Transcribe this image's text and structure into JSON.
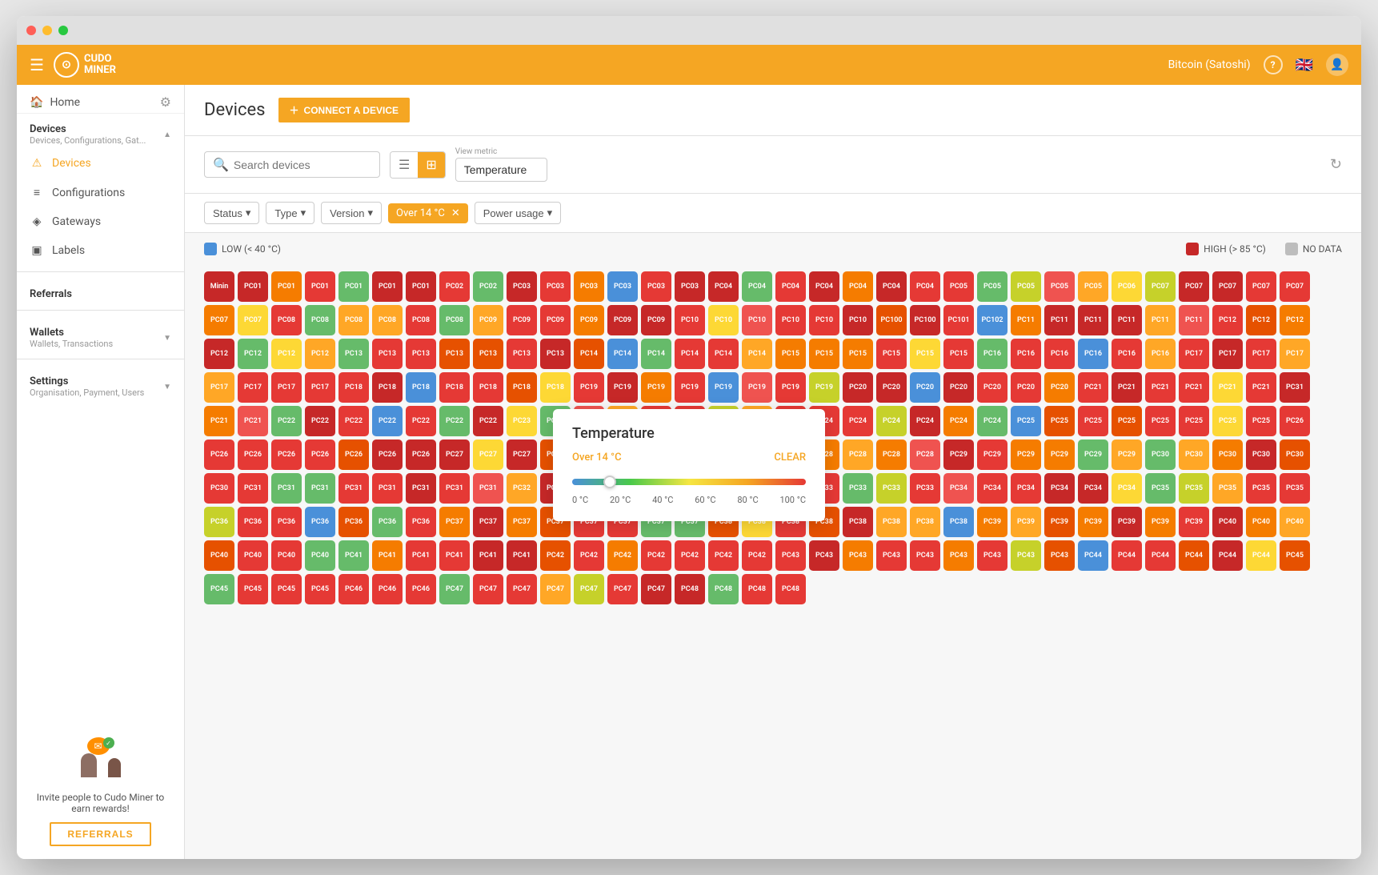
{
  "window": {
    "titlebar": {
      "dots": [
        "red",
        "yellow",
        "green"
      ]
    }
  },
  "topnav": {
    "logo_text": "CUDO\nMINER",
    "currency": "Bitcoin (Satoshi)",
    "help_icon": "?",
    "flag_icon": "🇬🇧"
  },
  "sidebar": {
    "home_label": "Home",
    "sections": [
      {
        "title": "Devices",
        "subtitle": "Devices, Configurations, Gat...",
        "items": [
          {
            "label": "Devices",
            "icon": "⚠",
            "active": true
          },
          {
            "label": "Configurations",
            "icon": "≡"
          },
          {
            "label": "Gateways",
            "icon": "◈"
          },
          {
            "label": "Labels",
            "icon": "▣"
          }
        ]
      },
      {
        "title": "Referrals",
        "subtitle": "",
        "items": []
      },
      {
        "title": "Wallets",
        "subtitle": "Wallets, Transactions",
        "items": []
      },
      {
        "title": "Settings",
        "subtitle": "Organisation, Payment, Users",
        "items": []
      }
    ],
    "promo": {
      "text": "Invite people to Cudo Miner to earn rewards!",
      "button_label": "REFERRALS"
    }
  },
  "content": {
    "title": "Devices",
    "connect_button": "CONNECT A DEVICE",
    "search_placeholder": "Search devices",
    "view_metric_label": "View metric",
    "view_metric_value": "Temperature",
    "filters": {
      "status_label": "Status",
      "type_label": "Type",
      "version_label": "Version",
      "active_filter": "Over 14 °C",
      "power_usage_label": "Power usage"
    },
    "legend": {
      "low_label": "LOW (< 40 °C)",
      "low_color": "#4a90d9",
      "high_label": "HIGH (> 85 °C)",
      "high_color": "#c62828",
      "no_data_label": "NO DATA",
      "no_data_color": "#bdbdbd"
    },
    "popup": {
      "title": "Temperature",
      "filter_active": "Over 14 °C",
      "clear_label": "CLEAR",
      "slider_value": 14,
      "labels": [
        "0 °C",
        "20 °C",
        "40 °C",
        "60 °C",
        "80 °C",
        "100 °C"
      ]
    }
  },
  "devices": {
    "colors": {
      "red_dark": "#c62828",
      "red": "#e53935",
      "orange_dark": "#e65100",
      "orange": "#f57c00",
      "orange_light": "#ffa726",
      "yellow": "#fdd835",
      "yellow_green": "#c6d12a",
      "green": "#66bb6a",
      "blue": "#4a90d9",
      "gray": "#bdbdbd"
    },
    "rows": [
      [
        "Minin",
        "PC01",
        "PC01",
        "PC01",
        "PC01",
        "PC01",
        "PC01",
        "PC02",
        "PC02",
        "PC03",
        "PC03",
        "PC03",
        "PC03",
        "PC03",
        "PC03",
        "PC04",
        "PC04",
        "PC04",
        "PC04",
        "PC04"
      ],
      [
        "PC04",
        "PC04",
        "PC05",
        "PC05",
        "PC05",
        "PC05",
        "PC05",
        "PC06",
        "PC07",
        "PC07",
        "PC07",
        "PC07",
        "PC07",
        "PC07",
        "PC07",
        "PC08",
        "PC08",
        "PC08",
        "PC08",
        "PC08"
      ],
      [
        "PC08",
        "PC09",
        "PC09",
        "PC09",
        "PC09",
        "PC09",
        "PC09",
        "PC10",
        "PC10",
        "PC10",
        "PC10",
        "PC10",
        "PC10",
        "PC100",
        "PC100",
        "PC101",
        "PC102",
        "PC11",
        "PC11",
        "PC11",
        "PC11",
        "PC11",
        "PC11",
        "PC12"
      ],
      [
        "PC12",
        "PC12",
        "PC12",
        "PC12",
        "PC12",
        "PC12",
        "PC13",
        "PC13",
        "PC13",
        "PC13",
        "PC13",
        "PC13",
        "PC13",
        "PC14",
        "PC14",
        "PC14",
        "PC14",
        "PC14",
        "PC14",
        "PC15",
        "PC15",
        "PC15",
        "PC15",
        "PC15",
        "PC15",
        "PC16"
      ],
      [
        "PC16",
        "PC16",
        "PC16",
        "PC16",
        "PC16",
        "PC17",
        "PC17",
        "PC17",
        "PC17",
        "PC17",
        "PC17",
        "PC17",
        "PC17",
        "PC18",
        "PC18",
        "PC18",
        "PC18",
        "PC18",
        "PC18",
        "PC18",
        "PC19",
        "PC19",
        "PC19",
        "PC19",
        "PC19",
        "PC19"
      ],
      [
        "PC19",
        "PC19",
        "PC20",
        "PC20",
        "PC20",
        "PC20",
        "PC20",
        "PC20",
        "PC20",
        "PC21",
        "PC21",
        "PC21",
        "PC21",
        "PC21",
        "PC21",
        "PC31",
        "PC21",
        "PC21",
        "PC22",
        "PC22",
        "PC22",
        "PC22",
        "PC22",
        "PC22",
        "PC22",
        "PC23",
        "PC23"
      ],
      [
        "PC23",
        "PC23",
        "PC23",
        "PC23",
        "PC23",
        "PC24",
        "PC24",
        "PC24",
        "PC24",
        "PC24",
        "PC24",
        "PC24",
        "PC24",
        "PC25",
        "PC25",
        "PC25",
        "PC25",
        "PC25",
        "PC25",
        "PC25",
        "PC25",
        "PC26",
        "PC26",
        "PC26",
        "PC26",
        "PC26"
      ],
      [
        "PC26",
        "PC26",
        "PC26",
        "PC27",
        "PC27",
        "PC27",
        "PC27",
        "PC27",
        "PC27",
        "PC27",
        "PC27",
        "PC28",
        "PC28",
        "PC28",
        "PC28",
        "PC28",
        "PC28",
        "PC28",
        "PC29",
        "PC29",
        "PC29",
        "PC29",
        "PC29",
        "PC29",
        "PC30"
      ],
      [
        "PC30",
        "PC30",
        "PC30",
        "PC30",
        "PC30",
        "PC31",
        "PC31",
        "PC31",
        "PC31",
        "PC31",
        "PC31",
        "PC31",
        "PC31",
        "PC32",
        "PC32",
        "PC32",
        "PC32",
        "PC32",
        "PC32",
        "PC33",
        "PC33",
        "PC33",
        "PC33",
        "PC33",
        "PC33",
        "PC33"
      ],
      [
        "PC34",
        "PC34",
        "PC34",
        "PC34",
        "PC34",
        "PC34",
        "PC35",
        "PC35",
        "PC35",
        "PC35",
        "PC35",
        "PC36",
        "PC36",
        "PC36",
        "PC36",
        "PC36",
        "PC36",
        "PC36",
        "PC37",
        "PC37",
        "PC37",
        "PC37",
        "PC37"
      ],
      [
        "PC37",
        "PC37",
        "PC37",
        "PC38",
        "PC38",
        "PC38",
        "PC38",
        "PC38",
        "PC38",
        "PC38",
        "PC38",
        "PC39",
        "PC39",
        "PC39",
        "PC39",
        "PC39",
        "PC39",
        "PC39",
        "PC40",
        "PC40",
        "PC40",
        "PC40",
        "PC40",
        "PC40",
        "PC40",
        "PC41"
      ],
      [
        "PC41",
        "PC41",
        "PC41",
        "PC41",
        "PC41",
        "PC42",
        "PC42",
        "PC42",
        "PC42",
        "PC42",
        "PC42",
        "PC42",
        "PC43",
        "PC43",
        "PC43",
        "PC43",
        "PC43",
        "PC43",
        "PC43",
        "PC43",
        "PC43",
        "PC44",
        "PC44",
        "PC44",
        "PC44",
        "PC44",
        "PC44"
      ],
      [
        "PC45",
        "PC45",
        "PC45",
        "PC45",
        "PC45",
        "PC46",
        "PC46",
        "PC46",
        "PC47",
        "PC47",
        "PC47",
        "PC47",
        "PC47",
        "PC47",
        "PC47",
        "PC48",
        "PC48",
        "PC48",
        "PC48"
      ]
    ]
  }
}
